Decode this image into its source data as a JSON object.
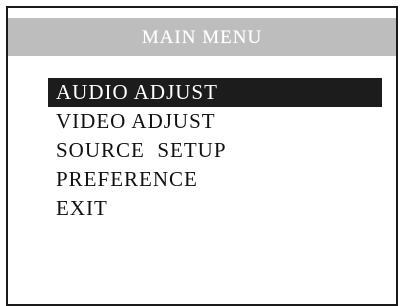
{
  "menu": {
    "title": "MAIN MENU",
    "items": [
      {
        "label": "AUDIO ADJUST",
        "selected": true
      },
      {
        "label": "VIDEO ADJUST",
        "selected": false
      },
      {
        "label": "SOURCE  SETUP",
        "selected": false
      },
      {
        "label": "PREFERENCE",
        "selected": false
      },
      {
        "label": "EXIT",
        "selected": false
      }
    ]
  },
  "colors": {
    "title_bar": "#bdbdbd",
    "title_text": "#ffffff",
    "highlight": "#1c1c1c",
    "frame": "#1a1a1a"
  }
}
